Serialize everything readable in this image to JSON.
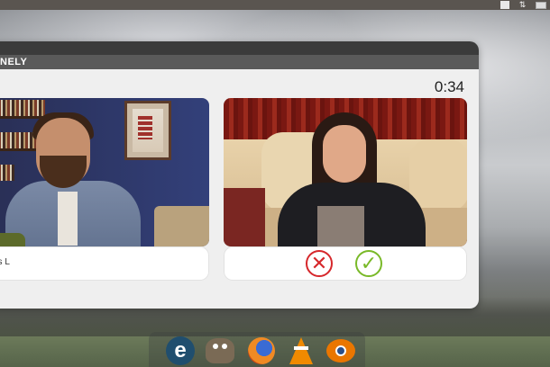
{
  "system_bar": {
    "tray_icons": [
      "battery-icon",
      "network-transfer-icon",
      "mail-icon"
    ],
    "network_glyph": "⇅"
  },
  "app": {
    "brand": "NELY",
    "timer": "0:34",
    "left_participant": {
      "name": "as L"
    },
    "right_participant": {
      "actions": [
        "reject",
        "accept"
      ]
    },
    "reject_glyph": "✕",
    "accept_glyph": "✓"
  },
  "dock": {
    "items": [
      "epiphany-browser-icon",
      "gimp-icon",
      "firefox-icon",
      "vlc-icon",
      "blender-icon"
    ],
    "epiphany_letter": "e"
  },
  "colors": {
    "window_bg": "#efefef",
    "titlebar": "#3b3b3b",
    "brandbar": "#5a5a5a",
    "reject": "#d6272b",
    "accept": "#79b928"
  }
}
